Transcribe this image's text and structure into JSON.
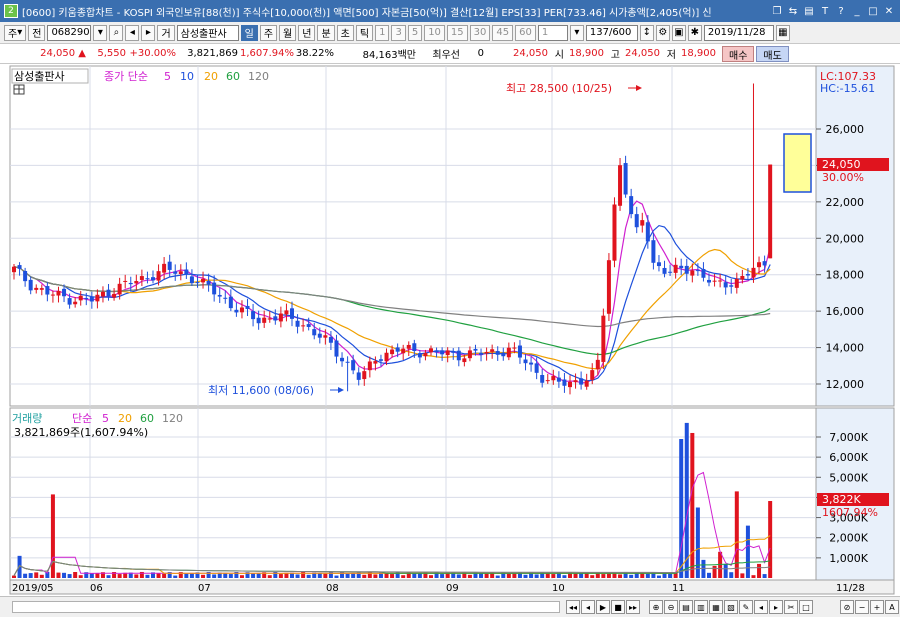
{
  "window": {
    "app_number": "2",
    "title": "[0600] 키움종합차트 - KOSPI 외국인보유[88(천)] 주식수[10,000(천)] 액면[500] 자본금[50(억)] 결산[12월] EPS[33] PER[733.46] 시가총액[2,405(억)] 신"
  },
  "toolbar": {
    "market": "주",
    "prev_label": "전",
    "code": "068290",
    "trade_label": "거",
    "stock_name": "삼성출판사",
    "periods": [
      "일",
      "주",
      "월",
      "년",
      "분",
      "초",
      "틱"
    ],
    "selected_period": "일",
    "intervals": [
      "1",
      "3",
      "5",
      "10",
      "15",
      "30",
      "45",
      "60"
    ],
    "count": "1",
    "bars": "137/600",
    "date": "2019/11/28"
  },
  "quote": {
    "price": "24,050",
    "change": "5,550",
    "change_pct": "+30.00%",
    "volume": "3,821,869",
    "volume_pct": "1,607.94%",
    "turnover": "38.22%",
    "amount": "84,163백만",
    "best_label": "최우선",
    "best_value": "0",
    "price2": "24,050",
    "open_label": "시",
    "open": "18,900",
    "high_label": "고",
    "high": "24,050",
    "low_label": "저",
    "low": "18,900",
    "buy_label": "매수",
    "sell_label": "매도"
  },
  "price_panel": {
    "stock_label": "삼성출판사",
    "ma_prefix": "종가 단순",
    "ma_periods": [
      "5",
      "10",
      "20",
      "60",
      "120"
    ],
    "lc_label": "LC:107.33",
    "hc_label": "HC:-15.61",
    "max_annotation": "최고 28,500 (10/25)",
    "min_annotation": "최저 11,600 (08/06)",
    "current_price_tag": "24,050",
    "current_pct_tag": "30.00%",
    "y_ticks": [
      "26,000",
      "24,000",
      "22,000",
      "20,000",
      "18,000",
      "16,000",
      "14,000",
      "12,000"
    ]
  },
  "volume_panel": {
    "label": "거래량",
    "ma_prefix": "단순",
    "ma_periods": [
      "5",
      "20",
      "60",
      "120"
    ],
    "value_label": "3,821,869주(1,607.94%)",
    "current_tag": "3,822K",
    "current_pct_tag": "1607.94%",
    "y_ticks": [
      "7,000K",
      "6,000K",
      "5,000K",
      "4,000K",
      "3,000K",
      "2,000K",
      "1,000K"
    ]
  },
  "x_axis": {
    "labels": [
      "2019/05",
      "06",
      "07",
      "08",
      "09",
      "10",
      "11"
    ],
    "right_label": "11/28"
  },
  "colors": {
    "up": "#e0141e",
    "down": "#1e50dc",
    "ma5": "#d020d0",
    "ma10": "#1e50dc",
    "ma20": "#f0a000",
    "ma60": "#20a040",
    "ma120": "#808080"
  },
  "chart_data": {
    "type": "candlestick",
    "date_range": [
      "2019/05",
      "2019/11/28"
    ],
    "y_range": [
      11000,
      29000
    ],
    "max": {
      "price": 28500,
      "date": "10/25"
    },
    "min": {
      "price": 11600,
      "date": "08/06"
    },
    "last": {
      "open": 18900,
      "high": 24050,
      "low": 18900,
      "close": 24050,
      "volume": 3821869
    }
  }
}
